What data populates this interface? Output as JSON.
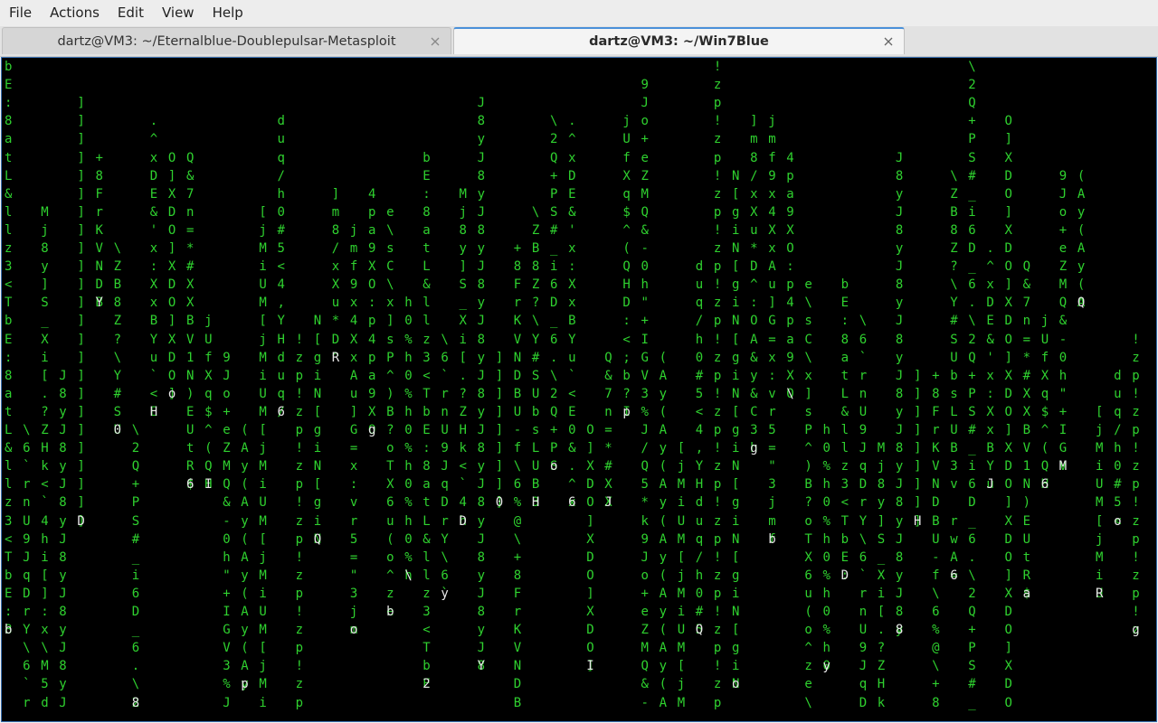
{
  "menubar": {
    "items": [
      "File",
      "Actions",
      "Edit",
      "View",
      "Help"
    ]
  },
  "tabs": [
    {
      "title": "dartz@VM3: ~/Eternalblue-Doublepulsar-Metasploit",
      "active": false
    },
    {
      "title": "dartz@VM3: ~/Win7Blue",
      "active": true
    }
  ],
  "terminal": {
    "background": "#000000",
    "rain_color": "#2fd12f",
    "highlight_color": "#e8e8e8",
    "columns": [
      "bE:8atL&llz3<T",
      "\\6`rnU9JqDrY",
      "Mj8y]S_Xi[.?ZHk<`4hi[]:x\\M5dz ePlKt6?",
      "J8y",
      "]",
      "+8FrKVNDBU-f\\6%@\\",
      "\\ZB8Z?\\Y#SUbsLUB3v rwA=Zw",
      "\\2Q+PS#_i6D_6.",
      ".^xDE&'x:XxBYu`<E0&",
      "O]XD",
      "Q&7n=*#XXBV1N)EUtR$=WxB3_8",
      "jUfXq$^(QHD:<;b?IK:%P5",
      "9Jo+eZMQ&-0h\"+IGV3%J/Q5*k",
      "(Ay",
      "[jMiUM",
      "duq/h0#5<4,YH",
      "!zp",
      "N[gi",
      "]m8/xXu*D^:OA&y&C3hmk$\\x>-uD]^\\",
      "jmf9x4XxAu]G=x:vr5=\"3",
      "4pa9XO:p",
      "e\\sC\\x]sP^)B?oTX6u(o^z",
      "h0%"
    ],
    "prompt_glyphs": [
      "b",
      "\\",
      "2",
      "y",
      "D",
      "Y",
      "0",
      "8",
      "H",
      "o",
      "6",
      "I",
      "J",
      "p",
      "a",
      "6",
      "M",
      "Q",
      "R",
      "o",
      "g"
    ]
  }
}
